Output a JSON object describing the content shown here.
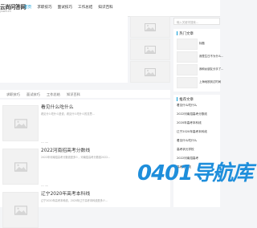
{
  "header": {
    "logo_title": "云尚问答网",
    "logo_sub": "yswd.cn",
    "nav": [
      "首页",
      "求职技巧",
      "面试技巧",
      "工作总结",
      "知识百科"
    ]
  },
  "search": {
    "placeholder": "输入关键词搜索..."
  },
  "tabs": [
    "求职技巧",
    "面试技巧",
    "工作总结",
    "知识百科"
  ],
  "articles": [
    {
      "title": "看见什么吃什么",
      "desc": "看见什么吃什么是说，看见什么吃什么的意思...",
      "meta": "04-08"
    },
    {
      "title": "2022河南招高考分数线",
      "desc": "2022年河南招高考分数线是多少，河南招高考分数线2022...",
      "meta": "04-08"
    },
    {
      "title": "辽宁2020年高考本科线",
      "desc": "辽宁2020年高考本科线，2020年辽宁高考本科线是多少...",
      "meta": "04-08"
    }
  ],
  "hot": {
    "title": "热门文章",
    "items": [
      "标题",
      "我是生日不为什么...",
      "我和女朋友分手了...",
      "上海地铁到达时间",
      "我和女朋友分手了"
    ]
  },
  "recommend": {
    "title": "推荐文章",
    "items": [
      "看见什么吃什么",
      "2022河南招高考分数线",
      "2020年高考本科线",
      "辽宁2020年高考本科线",
      "看见什么吃什么",
      "高考状元学校",
      "2022河南招高考",
      "高考分数线"
    ]
  },
  "watermark": "0401导航库"
}
